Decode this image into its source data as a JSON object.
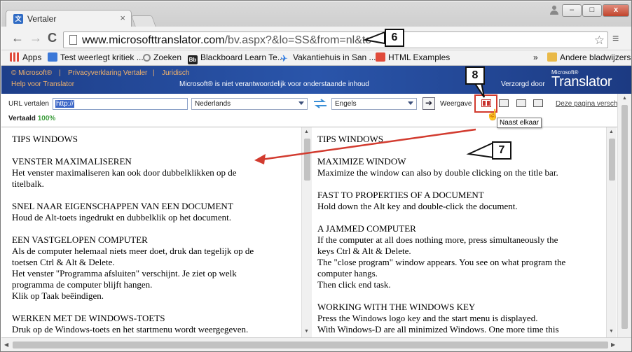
{
  "browser": {
    "tab_title": "Vertaler",
    "tab_close": "×",
    "url_host": "www.microsofttranslator.com",
    "url_path": "/bv.aspx?&lo=SS&from=nl&to=en",
    "star": "☆",
    "menu": "≡",
    "back": "←",
    "forward": "→",
    "reload": "C",
    "min": "–",
    "max": "□",
    "close": "x"
  },
  "bookmarks": [
    {
      "label": "Apps",
      "color": "#e04a3a"
    },
    {
      "label": "Test weerlegt kritiek ...",
      "color": "#3b78d8"
    },
    {
      "label": "Zoeken",
      "color": "#888888"
    },
    {
      "label": "Blackboard Learn Te...",
      "color": "#222222",
      "badge": "Bb"
    },
    {
      "label": "Vakantiehuis in San ...",
      "color": "#2c7be5"
    },
    {
      "label": "HTML Examples",
      "color": "#e04a3a"
    },
    {
      "label": "»",
      "color": ""
    },
    {
      "label": "Andere bladwijzers",
      "color": "#e9b948"
    }
  ],
  "banner": {
    "microsoft": "© Microsoft®",
    "privacy": "Privacyverklaring Vertaler",
    "legal": "Juridisch",
    "help": "Help voor Translator",
    "note": "Microsoft® is niet verantwoordelijk voor onderstaande inhoud",
    "by": "Verzorgd door",
    "ms": "Microsoft®",
    "logo": "Translator"
  },
  "controls": {
    "url_label": "URL vertalen",
    "url_value": "http://",
    "from_lang": "Nederlands",
    "to_lang": "Engels",
    "go": "➔",
    "view_label": "Weergave",
    "this_page": "Deze pagina versch",
    "translated_label": "Vertaald",
    "translated_pct": "100%",
    "tooltip": "Naast elkaar"
  },
  "left_pane": [
    {
      "lines": [
        "TIPS WINDOWS"
      ]
    },
    {
      "lines": [
        "VENSTER MAXIMALISEREN",
        "Het venster maximaliseren kan ook door dubbelklikken op de",
        "titelbalk."
      ]
    },
    {
      "lines": [
        "SNEL NAAR EIGENSCHAPPEN VAN EEN DOCUMENT",
        "Houd de Alt-toets ingedrukt en dubbelklik op het document."
      ]
    },
    {
      "lines": [
        "EEN VASTGELOPEN COMPUTER",
        "Als de computer helemaal niets meer doet, druk dan tegelijk op de",
        "toetsen Ctrl & Alt & Delete.",
        "Het venster \"Programma afsluiten\" verschijnt. Je ziet op welk",
        "programma de computer blijft hangen.",
        "Klik op Taak beëindigen."
      ]
    },
    {
      "lines": [
        "WERKEN MET DE WINDOWS-TOETS",
        "Druk op de Windows-toets en het startmenu wordt weergegeven."
      ]
    }
  ],
  "right_pane": [
    {
      "lines": [
        "TIPS WINDOWS"
      ]
    },
    {
      "lines": [
        "MAXIMIZE WINDOW",
        "Maximize the window can also by double clicking on the title bar."
      ]
    },
    {
      "lines": [
        "FAST TO PROPERTIES OF A DOCUMENT",
        "Hold down the Alt key and double-click the document."
      ]
    },
    {
      "lines": [
        "A JAMMED COMPUTER",
        "If the computer at all does nothing more, press simultaneously the",
        "keys Ctrl & Alt & Delete.",
        "The \"close program\" window appears. You see on what program the",
        "computer hangs.",
        "Then click end task."
      ]
    },
    {
      "lines": [
        "WORKING WITH THE WINDOWS KEY",
        "Press the Windows logo key and the start menu is displayed.",
        "With Windows-D are all minimized Windows. One more time this"
      ]
    }
  ],
  "callouts": {
    "six": "6",
    "seven": "7",
    "eight": "8"
  },
  "colors": {
    "annotation_red": "#d23b2f",
    "banner_blue": "#2a55aa",
    "translated_green": "#3e9e3e"
  }
}
